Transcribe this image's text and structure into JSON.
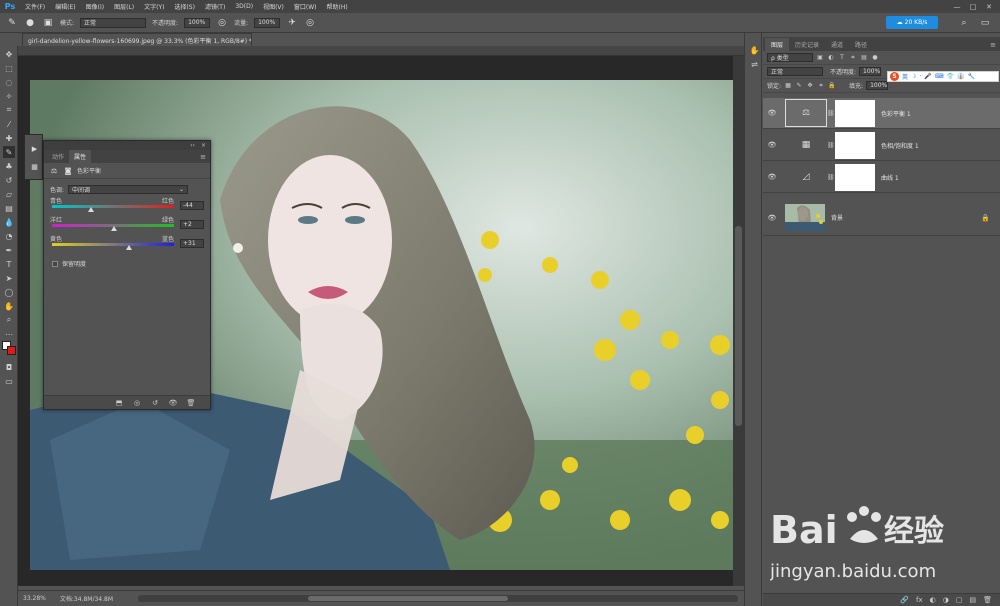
{
  "app": {
    "logo": "Ps"
  },
  "menu": [
    "文件(F)",
    "编辑(E)",
    "图像(I)",
    "图层(L)",
    "文字(Y)",
    "选择(S)",
    "滤镜(T)",
    "3D(D)",
    "视图(V)",
    "窗口(W)",
    "帮助(H)"
  ],
  "window_controls": [
    "—",
    "□",
    "✕"
  ],
  "options_bar": {
    "mode_label": "模式:",
    "mode_value": "正常",
    "opacity_label": "不透明度:",
    "opacity_value": "100%",
    "flow_label": "流量:",
    "flow_value": "100%",
    "speed_badge": "20 KB/s"
  },
  "document": {
    "tab_title": "girl-dandelion-yellow-flowers-160699.jpeg @ 33.3% (色彩平衡 1, RGB/8#) *",
    "tab_close": "×"
  },
  "status": {
    "zoom": "33.28%",
    "doc_info": "文档:34.8M/34.8M"
  },
  "properties": {
    "collapse": "‹‹",
    "menu": "≡",
    "close": "×",
    "tabs": [
      "动作",
      "属性"
    ],
    "title": "色彩平衡",
    "tone_label": "色调:",
    "tone_value": "中间调",
    "sliders": [
      {
        "left": "青色",
        "right": "红色",
        "value": "-44",
        "fraction": 0.32,
        "colors": [
          "#00c8c8",
          "#e02020"
        ]
      },
      {
        "left": "洋红",
        "right": "绿色",
        "value": "+2",
        "fraction": 0.51,
        "colors": [
          "#d020d0",
          "#20c020"
        ]
      },
      {
        "left": "黄色",
        "right": "蓝色",
        "value": "+31",
        "fraction": 0.63,
        "colors": [
          "#e0d020",
          "#2020e0"
        ]
      }
    ],
    "preserve_label": "保留明度"
  },
  "layers_panel": {
    "tabs": [
      "图层",
      "历史记录",
      "通道",
      "路径"
    ],
    "kind_label": "ρ 类型",
    "blend_mode": "正常",
    "opacity_label": "不透明度:",
    "opacity_value": "100%",
    "lock_label": "锁定:",
    "fill_label": "填充:",
    "fill_value": "100%",
    "sogou": {
      "logo": "S",
      "items": [
        "英",
        "☽",
        "·",
        "🎤",
        "⌨",
        "👕",
        "👔",
        "🔧"
      ]
    },
    "layers": [
      {
        "name": "色彩平衡 1",
        "icon": "⚖",
        "selected": true
      },
      {
        "name": "色相/饱和度 1",
        "icon": "▦",
        "selected": false
      },
      {
        "name": "曲线 1",
        "icon": "◿",
        "selected": false
      },
      {
        "name": "背景",
        "icon": "",
        "selected": false
      }
    ],
    "footer_icons": [
      "🔗",
      "fx",
      "◐",
      "◑",
      "▢",
      "▤",
      "🗑"
    ]
  },
  "watermark": {
    "brand": "Baidu经验",
    "url": "jingyan.baidu.com"
  }
}
